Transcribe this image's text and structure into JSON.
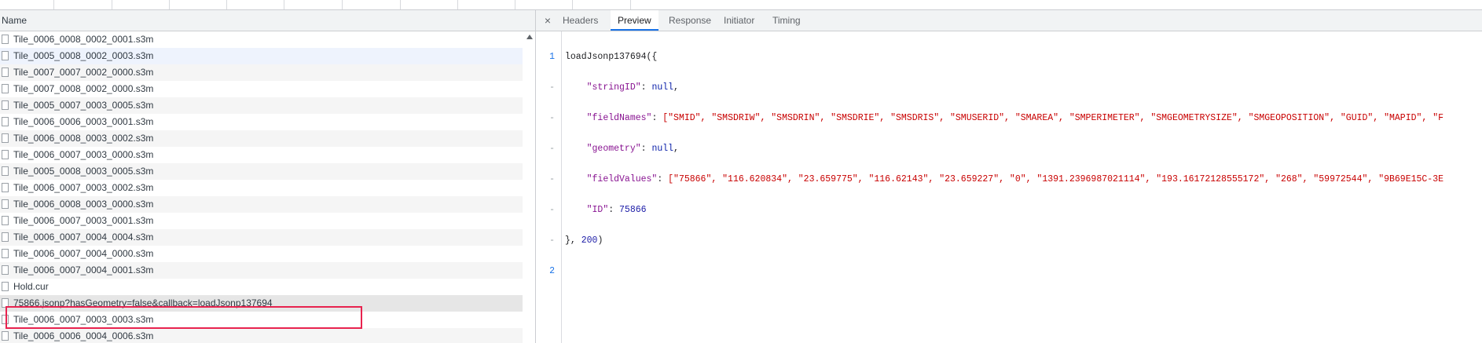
{
  "list": {
    "header": "Name",
    "rows": [
      "Tile_0006_0008_0002_0001.s3m",
      "Tile_0005_0008_0002_0003.s3m",
      "Tile_0007_0007_0002_0000.s3m",
      "Tile_0007_0008_0002_0000.s3m",
      "Tile_0005_0007_0003_0005.s3m",
      "Tile_0006_0006_0003_0001.s3m",
      "Tile_0006_0008_0003_0002.s3m",
      "Tile_0006_0007_0003_0000.s3m",
      "Tile_0005_0008_0003_0005.s3m",
      "Tile_0006_0007_0003_0002.s3m",
      "Tile_0006_0008_0003_0000.s3m",
      "Tile_0006_0007_0003_0001.s3m",
      "Tile_0006_0007_0004_0004.s3m",
      "Tile_0006_0007_0004_0000.s3m",
      "Tile_0006_0007_0004_0001.s3m",
      "Hold.cur",
      "75866.jsonp?hasGeometry=false&callback=loadJsonp137694",
      "Tile_0006_0007_0003_0003.s3m",
      "Tile_0006_0006_0004_0006.s3m"
    ]
  },
  "tabs": {
    "close": "×",
    "headers": "Headers",
    "preview": "Preview",
    "response": "Response",
    "initiator": "Initiator",
    "timing": "Timing"
  },
  "preview": {
    "gutter": [
      "1",
      "-",
      "-",
      "-",
      "-",
      "-",
      "-",
      "2"
    ],
    "l1_fn": "loadJsonp137694({",
    "l2_key": "\"stringID\"",
    "l2_val": "null",
    "l3_key": "\"fieldNames\"",
    "l3_val": "[\"SMID\", \"SMSDRIW\", \"SMSDRIN\", \"SMSDRIE\", \"SMSDRIS\", \"SMUSERID\", \"SMAREA\", \"SMPERIMETER\", \"SMGEOMETRYSIZE\", \"SMGEOPOSITION\", \"GUID\", \"MAPID\", \"F",
    "l4_key": "\"geometry\"",
    "l4_val": "null",
    "l5_key": "\"fieldValues\"",
    "l5_val": "[\"75866\", \"116.620834\", \"23.659775\", \"116.62143\", \"23.659227\", \"0\", \"1391.2396987021114\", \"193.16172128555172\", \"268\", \"59972544\", \"9B69E15C-3E",
    "l6_key": "\"ID\"",
    "l6_val": "75866",
    "l7_close": "}, ",
    "l7_num": "200",
    "l7_end": ")"
  }
}
